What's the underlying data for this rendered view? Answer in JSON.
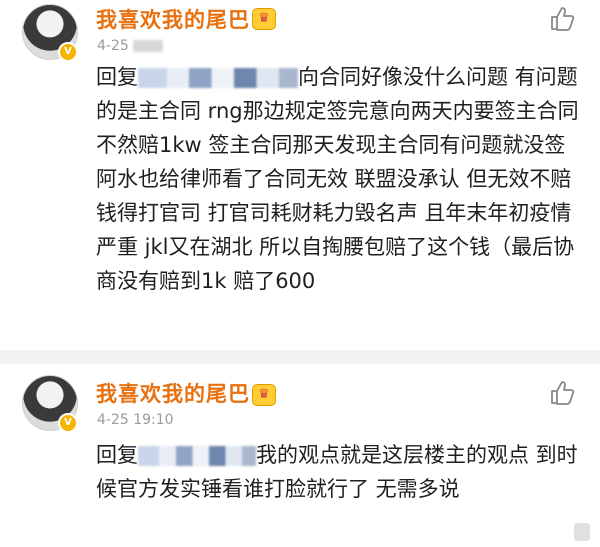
{
  "posts": [
    {
      "username": "我喜欢我的尾巴",
      "time": "4-25",
      "reply_prefix": "回复",
      "text": "向合同好像没什么问题 有问题的是主合同 rng那边规定签完意向两天内要签主合同 不然赔1kw 签主合同那天发现主合同有问题就没签 阿水也给律师看了合同无效 联盟没承认 但无效不赔钱得打官司 打官司耗财耗力毁名声 且年末年初疫情严重 jkl又在湖北 所以自掏腰包赔了这个钱（最后协商没有赔到1k 赔了600"
    },
    {
      "username": "我喜欢我的尾巴",
      "time": "4-25 19:10",
      "reply_prefix": "回复",
      "text": "我的观点就是这层楼主的观点 到时候官方发实锤看谁打脸就行了 无需多说"
    }
  ],
  "icons": {
    "avatar": "avatar",
    "verified": "verified-v-icon",
    "crown": "crown-badge-icon",
    "like": "thumbs-up-icon"
  },
  "colors": {
    "username": "#e8700f",
    "badge": "#f5b400",
    "time": "#9a9a9a",
    "text": "#1f1f1f",
    "divider": "#f2f2f2"
  }
}
